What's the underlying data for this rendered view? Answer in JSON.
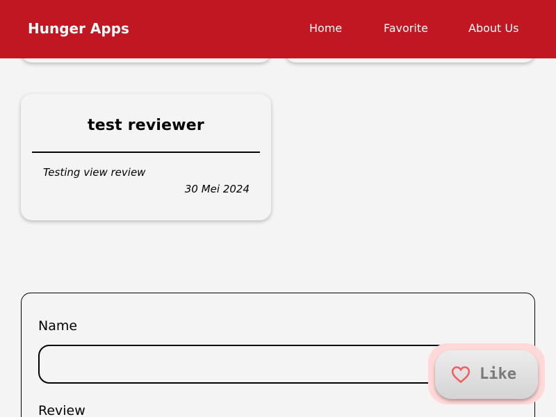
{
  "header": {
    "brand": "Hunger Apps",
    "nav": {
      "home": "Home",
      "favorite": "Favorite",
      "about": "About Us"
    },
    "color": "#c01722"
  },
  "reviews": [
    {
      "name": "test reviewer",
      "text": "Testing view review",
      "date": "30 Mei 2024"
    }
  ],
  "form": {
    "name_label": "Name",
    "name_value": "",
    "review_label": "Review"
  },
  "like_button": {
    "label": "Like",
    "icon": "heart-outline-icon",
    "icon_color": "#f25c5c"
  }
}
